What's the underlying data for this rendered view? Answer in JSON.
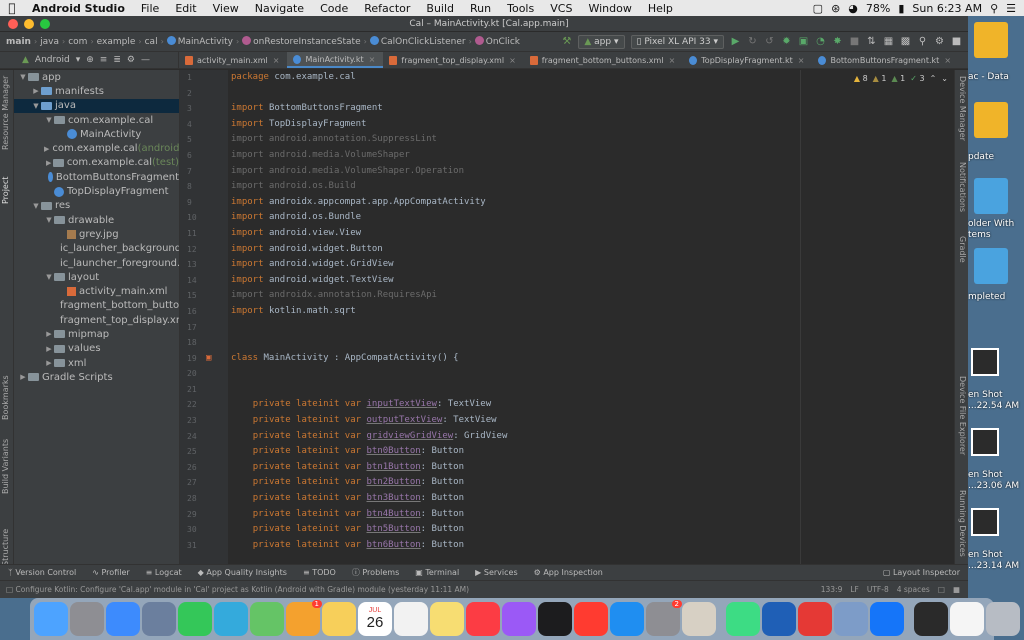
{
  "menubar": {
    "app_name": "Android Studio",
    "items": [
      "File",
      "Edit",
      "View",
      "Navigate",
      "Code",
      "Refactor",
      "Build",
      "Run",
      "Tools",
      "VCS",
      "Window",
      "Help"
    ],
    "battery": "78%",
    "clock": "Sun 6:23 AM"
  },
  "window": {
    "title": "Cal – MainActivity.kt [Cal.app.main]"
  },
  "navbar": {
    "crumbs": [
      "main",
      "java",
      "com",
      "example",
      "cal",
      "MainActivity",
      "onRestoreInstanceState",
      "CalOnClickListener",
      "OnClick"
    ],
    "run_config": "app",
    "device": "Pixel XL API 33"
  },
  "project_panel": {
    "view_mode": "Android",
    "tree": [
      {
        "label": "app",
        "depth": 0,
        "arrow": "v",
        "icon": "folder"
      },
      {
        "label": "manifests",
        "depth": 1,
        "arrow": ">",
        "icon": "folder-blue"
      },
      {
        "label": "java",
        "depth": 1,
        "arrow": "v",
        "icon": "folder-blue",
        "selected": true
      },
      {
        "label": "com.example.cal",
        "depth": 2,
        "arrow": "v",
        "icon": "folder"
      },
      {
        "label": "MainActivity",
        "depth": 3,
        "arrow": "",
        "icon": "kotlin"
      },
      {
        "label": "com.example.cal",
        "suffix": "(androidTest)",
        "depth": 2,
        "arrow": ">",
        "icon": "folder"
      },
      {
        "label": "com.example.cal",
        "suffix": "(test)",
        "depth": 2,
        "arrow": ">",
        "icon": "folder"
      },
      {
        "label": "BottomButtonsFragment",
        "depth": 2,
        "arrow": "",
        "icon": "kotlin"
      },
      {
        "label": "TopDisplayFragment",
        "depth": 2,
        "arrow": "",
        "icon": "kotlin"
      },
      {
        "label": "res",
        "depth": 1,
        "arrow": "v",
        "icon": "folder"
      },
      {
        "label": "drawable",
        "depth": 2,
        "arrow": "v",
        "icon": "folder"
      },
      {
        "label": "grey.jpg",
        "depth": 3,
        "arrow": "",
        "icon": "image"
      },
      {
        "label": "ic_launcher_background.xml",
        "depth": 3,
        "arrow": "",
        "icon": "xml"
      },
      {
        "label": "ic_launcher_foreground.xml",
        "depth": 3,
        "arrow": "",
        "icon": "xml"
      },
      {
        "label": "layout",
        "depth": 2,
        "arrow": "v",
        "icon": "folder"
      },
      {
        "label": "activity_main.xml",
        "depth": 3,
        "arrow": "",
        "icon": "xml"
      },
      {
        "label": "fragment_bottom_buttons.xml",
        "depth": 3,
        "arrow": "",
        "icon": "xml"
      },
      {
        "label": "fragment_top_display.xml",
        "depth": 3,
        "arrow": "",
        "icon": "xml"
      },
      {
        "label": "mipmap",
        "depth": 2,
        "arrow": ">",
        "icon": "folder"
      },
      {
        "label": "values",
        "depth": 2,
        "arrow": ">",
        "icon": "folder"
      },
      {
        "label": "xml",
        "depth": 2,
        "arrow": ">",
        "icon": "folder"
      },
      {
        "label": "Gradle Scripts",
        "depth": 0,
        "arrow": ">",
        "icon": "gradle"
      }
    ]
  },
  "editor_tabs": [
    {
      "label": "activity_main.xml",
      "active": false,
      "type": "xml"
    },
    {
      "label": "MainActivity.kt",
      "active": true,
      "type": "kotlin"
    },
    {
      "label": "fragment_top_display.xml",
      "active": false,
      "type": "xml"
    },
    {
      "label": "fragment_bottom_buttons.xml",
      "active": false,
      "type": "xml"
    },
    {
      "label": "TopDisplayFragment.kt",
      "active": false,
      "type": "kotlin"
    },
    {
      "label": "BottomButtonsFragment.kt",
      "active": false,
      "type": "kotlin"
    }
  ],
  "inspections": {
    "warnings": "8",
    "weak": "1",
    "typos": "1",
    "ok": "3"
  },
  "code_lines": [
    {
      "n": "1",
      "parts": [
        [
          "kw",
          "package "
        ],
        [
          "",
          "com.example.cal"
        ]
      ]
    },
    {
      "n": "2",
      "parts": []
    },
    {
      "n": "3",
      "parts": [
        [
          "kw",
          "import "
        ],
        [
          "",
          "BottomButtonsFragment"
        ]
      ]
    },
    {
      "n": "4",
      "parts": [
        [
          "kw",
          "import "
        ],
        [
          "",
          "TopDisplayFragment"
        ]
      ]
    },
    {
      "n": "5",
      "parts": [
        [
          "dim",
          "import android.annotation.SuppressLint"
        ]
      ]
    },
    {
      "n": "6",
      "parts": [
        [
          "dim",
          "import android.media.VolumeShaper"
        ]
      ]
    },
    {
      "n": "7",
      "parts": [
        [
          "dim",
          "import android.media.VolumeShaper.Operation"
        ]
      ]
    },
    {
      "n": "8",
      "parts": [
        [
          "dim",
          "import android.os.Build"
        ]
      ]
    },
    {
      "n": "9",
      "parts": [
        [
          "kw",
          "import "
        ],
        [
          "",
          "androidx.appcompat.app.AppCompatActivity"
        ]
      ]
    },
    {
      "n": "10",
      "parts": [
        [
          "kw",
          "import "
        ],
        [
          "",
          "android.os.Bundle"
        ]
      ]
    },
    {
      "n": "11",
      "parts": [
        [
          "kw",
          "import "
        ],
        [
          "",
          "android.view.View"
        ]
      ]
    },
    {
      "n": "12",
      "parts": [
        [
          "kw",
          "import "
        ],
        [
          "",
          "android.widget.Button"
        ]
      ]
    },
    {
      "n": "13",
      "parts": [
        [
          "kw",
          "import "
        ],
        [
          "",
          "android.widget.GridView"
        ]
      ]
    },
    {
      "n": "14",
      "parts": [
        [
          "kw",
          "import "
        ],
        [
          "",
          "android.widget.TextView"
        ]
      ]
    },
    {
      "n": "15",
      "parts": [
        [
          "dim",
          "import androidx.annotation.RequiresApi"
        ]
      ]
    },
    {
      "n": "16",
      "parts": [
        [
          "kw",
          "import "
        ],
        [
          "",
          "kotlin.math.sqrt"
        ]
      ]
    },
    {
      "n": "17",
      "parts": []
    },
    {
      "n": "18",
      "parts": []
    },
    {
      "n": "19",
      "parts": [
        [
          "kw",
          "class "
        ],
        [
          "",
          "MainActivity : AppCompatActivity() {"
        ]
      ]
    },
    {
      "n": "20",
      "parts": []
    },
    {
      "n": "21",
      "parts": []
    },
    {
      "n": "22",
      "parts": [
        [
          "",
          "    "
        ],
        [
          "kw",
          "private lateinit var "
        ],
        [
          "fld",
          "inputTextView"
        ],
        [
          "",
          ": TextView"
        ]
      ]
    },
    {
      "n": "23",
      "parts": [
        [
          "",
          "    "
        ],
        [
          "kw",
          "private lateinit var "
        ],
        [
          "fld",
          "outputTextView"
        ],
        [
          "",
          ": TextView"
        ]
      ]
    },
    {
      "n": "24",
      "parts": [
        [
          "",
          "    "
        ],
        [
          "kw",
          "private lateinit var "
        ],
        [
          "fld",
          "gridviewGridView"
        ],
        [
          "",
          ": GridView"
        ]
      ]
    },
    {
      "n": "25",
      "parts": [
        [
          "",
          "    "
        ],
        [
          "kw",
          "private lateinit var "
        ],
        [
          "fld",
          "btn0Button"
        ],
        [
          "",
          ": Button"
        ]
      ]
    },
    {
      "n": "26",
      "parts": [
        [
          "",
          "    "
        ],
        [
          "kw",
          "private lateinit var "
        ],
        [
          "fld",
          "btn1Button"
        ],
        [
          "",
          ": Button"
        ]
      ]
    },
    {
      "n": "27",
      "parts": [
        [
          "",
          "    "
        ],
        [
          "kw",
          "private lateinit var "
        ],
        [
          "fld",
          "btn2Button"
        ],
        [
          "",
          ": Button"
        ]
      ]
    },
    {
      "n": "28",
      "parts": [
        [
          "",
          "    "
        ],
        [
          "kw",
          "private lateinit var "
        ],
        [
          "fld",
          "btn3Button"
        ],
        [
          "",
          ": Button"
        ]
      ]
    },
    {
      "n": "29",
      "parts": [
        [
          "",
          "    "
        ],
        [
          "kw",
          "private lateinit var "
        ],
        [
          "fld",
          "btn4Button"
        ],
        [
          "",
          ": Button"
        ]
      ]
    },
    {
      "n": "30",
      "parts": [
        [
          "",
          "    "
        ],
        [
          "kw",
          "private lateinit var "
        ],
        [
          "fld",
          "btn5Button"
        ],
        [
          "",
          ": Button"
        ]
      ]
    },
    {
      "n": "31",
      "parts": [
        [
          "",
          "    "
        ],
        [
          "kw",
          "private lateinit var "
        ],
        [
          "fld",
          "btn6Button"
        ],
        [
          "",
          ": Button"
        ]
      ]
    }
  ],
  "left_strip": [
    "Resource Manager",
    "Project",
    "Bookmarks",
    "Build Variants",
    "Structure"
  ],
  "right_strip": [
    "Device Manager",
    "Notifications",
    "Gradle",
    "Device File Explorer",
    "Running Devices"
  ],
  "bottom_tools": [
    "Version Control",
    "Profiler",
    "Logcat",
    "App Quality Insights",
    "TODO",
    "Problems",
    "Terminal",
    "Services",
    "App Inspection"
  ],
  "layout_inspector": "Layout Inspector",
  "status": {
    "message": "Configure Kotlin: Configure 'Cal.app' module in 'Cal' project as Kotlin (Android with Gradle) module (yesterday 11:11 AM)",
    "position": "133:9",
    "line_sep": "LF",
    "encoding": "UTF-8",
    "indent": "4 spaces"
  },
  "desktop": [
    {
      "label": "ac - Data",
      "type": "hd"
    },
    {
      "label": "pdate",
      "type": "hd"
    },
    {
      "label": "older With",
      "label2": "tems",
      "type": "folder"
    },
    {
      "label": "mpleted",
      "type": "folder"
    },
    {
      "label": "en Shot",
      "label2": "...22.54 AM",
      "type": "shot"
    },
    {
      "label": "en Shot",
      "label2": "...23.06 AM",
      "type": "shot"
    },
    {
      "label": "en Shot",
      "label2": "...23.14 AM",
      "type": "shot"
    }
  ],
  "dock": {
    "calendar_day": "26",
    "calendar_month": "JUL",
    "icons": [
      "finder-icon",
      "launchpad-icon",
      "safari-icon",
      "preview-icon",
      "facetime-icon",
      "messages-icon",
      "maps-icon",
      "photos-icon",
      "notes-icon",
      "calendar-icon",
      "reminders-icon",
      "stickies-icon",
      "music-icon",
      "podcasts-icon",
      "tv-icon",
      "news-icon",
      "app-store-icon",
      "system-preferences-icon",
      "script-editor-icon",
      "android-studio-icon",
      "sourcetree-icon",
      "screen-recorder-icon",
      "photo-viewer-icon",
      "xcode-icon",
      "terminal-icon",
      "document-icon",
      "trash-icon"
    ],
    "badges": {
      "photos": "1",
      "system_preferences": "2"
    }
  },
  "colors": {
    "accent": "#4a88c7",
    "keyword": "#cc7832",
    "field": "#9876aa",
    "comment_dim": "#6b6b6b",
    "text": "#a9b7c6",
    "panel": "#3c3f41",
    "editor_bg": "#2b2b2b"
  }
}
